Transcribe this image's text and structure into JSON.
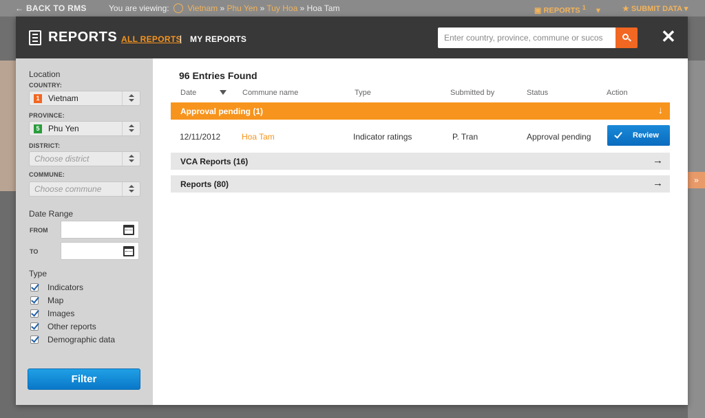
{
  "topbar": {
    "back_label": "BACK TO RMS",
    "viewing_label": "You are viewing:",
    "breadcrumb": [
      "Vietnam",
      "Phu Yen",
      "Tuy Hoa",
      "Hoa Tam"
    ],
    "breadcrumb_sep": "»",
    "reports_label": "REPORTS",
    "reports_badge": "1",
    "submit_label": "SUBMIT DATA"
  },
  "modal": {
    "title": "REPORTS",
    "tabs": {
      "all": "ALL REPORTS",
      "separator": "|",
      "mine": "MY REPORTS"
    },
    "search_placeholder": "Enter country, province, commune or sucos",
    "close_glyph": "✕"
  },
  "sidebar": {
    "location_heading": "Location",
    "country": {
      "label": "COUNTRY:",
      "value": "Vietnam",
      "num": "1",
      "num_color": "#f26722"
    },
    "province": {
      "label": "PROVINCE:",
      "value": "Phu Yen",
      "num": "5",
      "num_color": "#2a9d3c"
    },
    "district": {
      "label": "DISTRICT:",
      "placeholder": "Choose district"
    },
    "commune": {
      "label": "COMMUNE:",
      "placeholder": "Choose commune"
    },
    "date_heading": "Date Range",
    "from_label": "FROM",
    "to_label": "TO",
    "type_heading": "Type",
    "types": [
      "Indicators",
      "Map",
      "Images",
      "Other reports",
      "Demographic data"
    ],
    "filter_label": "Filter"
  },
  "results": {
    "count_text": "96 Entries Found",
    "columns": [
      "Date",
      "Commune name",
      "Type",
      "Submitted by",
      "Status",
      "Action"
    ],
    "groups": {
      "pending": "Approval pending (1)",
      "vca": "VCA Reports (16)",
      "reports": "Reports (80)"
    },
    "row": {
      "date": "12/11/2012",
      "commune": "Hoa Tam",
      "type": "Indicator ratings",
      "submitted_by": "P. Tran",
      "status": "Approval pending",
      "action": "Review"
    },
    "arrow_down": "↓",
    "arrow_right": "→"
  },
  "colors": {
    "accent": "#f7941d",
    "primary": "#0a77c8",
    "header": "#383838"
  }
}
